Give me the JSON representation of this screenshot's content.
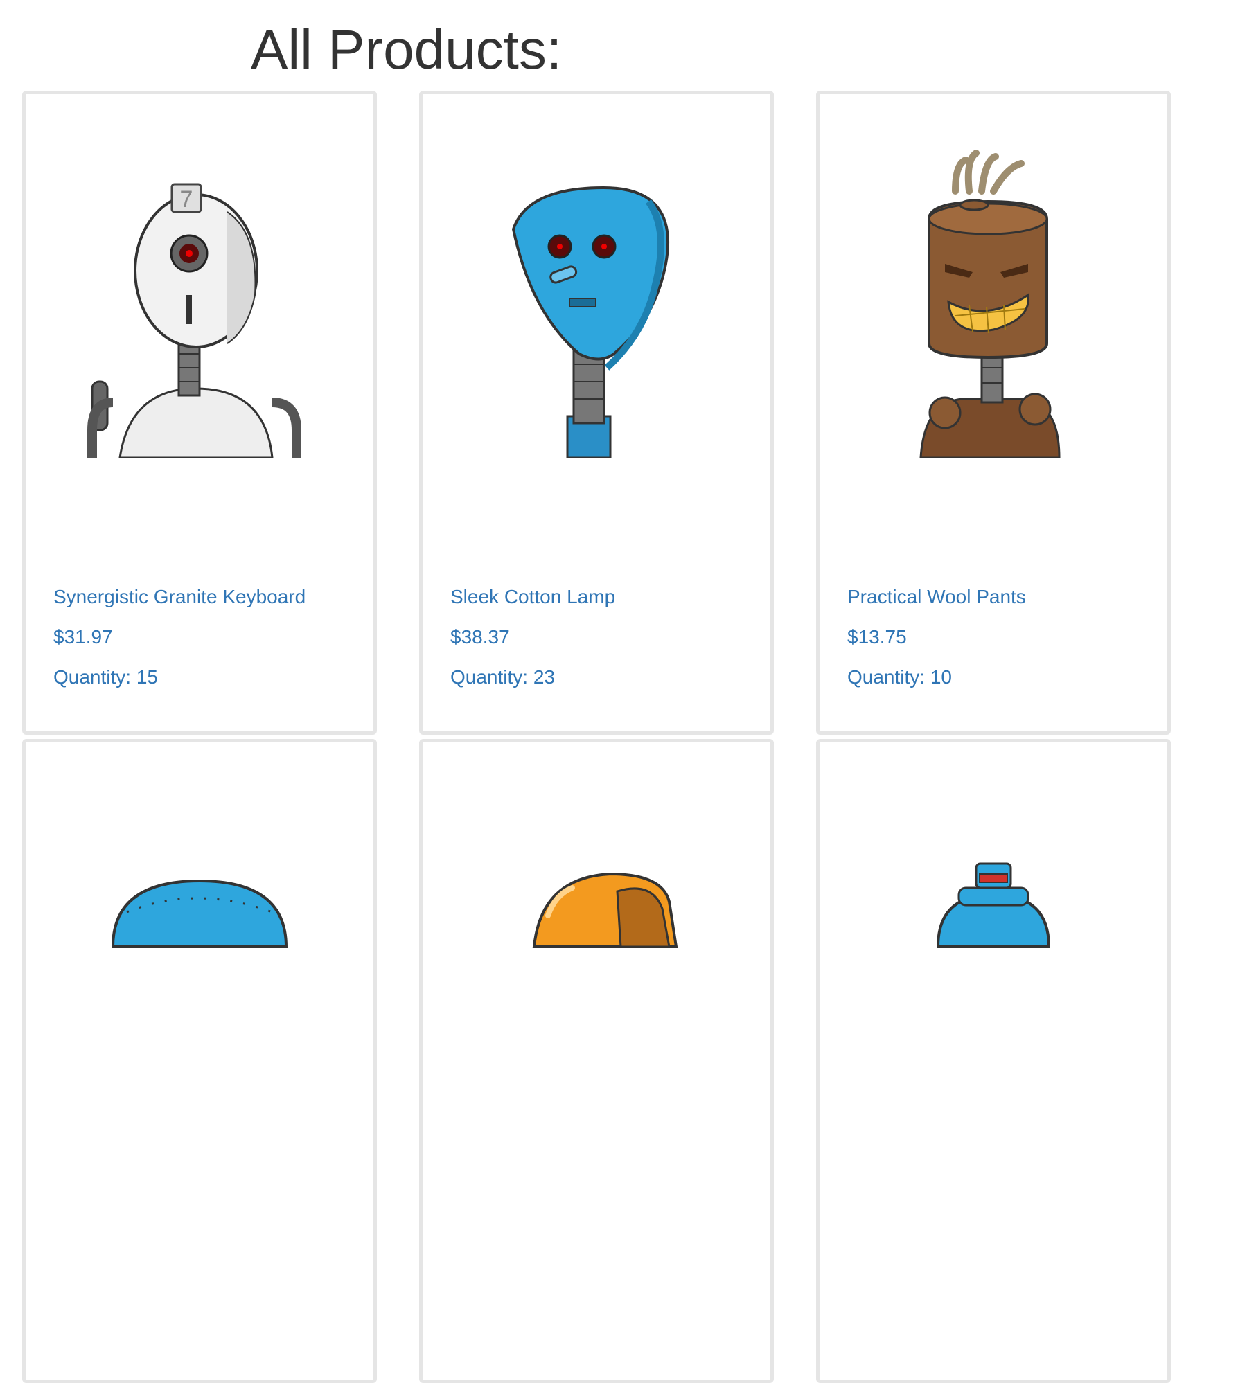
{
  "page": {
    "title": "All Products:"
  },
  "colors": {
    "link": "#2f75b5",
    "card_border": "#e5e5e5",
    "title": "#333333"
  },
  "products": [
    {
      "name": "Synergistic Granite Keyboard",
      "price": "$31.97",
      "quantity": "Quantity: 15",
      "image": "white-robot-7-icon"
    },
    {
      "name": "Sleek Cotton Lamp",
      "price": "$38.37",
      "quantity": "Quantity: 23",
      "image": "blue-shield-robot-icon"
    },
    {
      "name": "Practical Wool Pants",
      "price": "$13.75",
      "quantity": "Quantity: 10",
      "image": "wooden-tiki-robot-icon"
    },
    {
      "image": "blue-dome-robot-icon"
    },
    {
      "image": "orange-helmet-robot-icon"
    },
    {
      "image": "blue-bottle-robot-icon"
    }
  ]
}
